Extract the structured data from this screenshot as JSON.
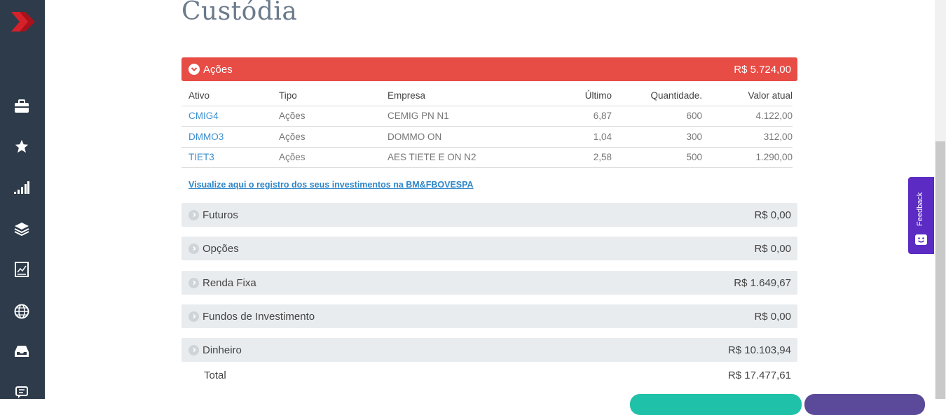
{
  "page": {
    "title": "Custódia"
  },
  "sidebar": {
    "icons": [
      "briefcase-icon",
      "star-icon",
      "signal-bars-icon",
      "layers-icon",
      "report-chart-icon",
      "globe-icon",
      "inbox-icon",
      "chat-icon"
    ]
  },
  "acoes": {
    "label": "Ações",
    "total": "R$ 5.724,00",
    "color": "#e74c45",
    "columns": [
      "Ativo",
      "Tipo",
      "Empresa",
      "Último",
      "Quantidade.",
      "Valor atual"
    ],
    "rows": [
      {
        "ativo": "CMIG4",
        "tipo": "Ações",
        "empresa": "CEMIG PN N1",
        "ultimo": "6,87",
        "quantidade": "600",
        "valor": "4.122,00"
      },
      {
        "ativo": "DMMO3",
        "tipo": "Ações",
        "empresa": "DOMMO ON",
        "ultimo": "1,04",
        "quantidade": "300",
        "valor": "312,00"
      },
      {
        "ativo": "TIET3",
        "tipo": "Ações",
        "empresa": "AES TIETE E ON N2",
        "ultimo": "2,58",
        "quantidade": "500",
        "valor": "1.290,00"
      }
    ],
    "link": "Visualize aqui o registro dos seus investimentos na BM&FBOVESPA"
  },
  "sections": [
    {
      "label": "Futuros",
      "value": "R$ 0,00"
    },
    {
      "label": "Opções",
      "value": "R$ 0,00"
    },
    {
      "label": "Renda Fixa",
      "value": "R$ 1.649,67"
    },
    {
      "label": "Fundos de Investimento",
      "value": "R$ 0,00"
    },
    {
      "label": "Dinheiro",
      "value": "R$ 10.103,94"
    }
  ],
  "total": {
    "label": "Total",
    "value": "R$ 17.477,61"
  },
  "feedback": {
    "label": "Feedback"
  }
}
